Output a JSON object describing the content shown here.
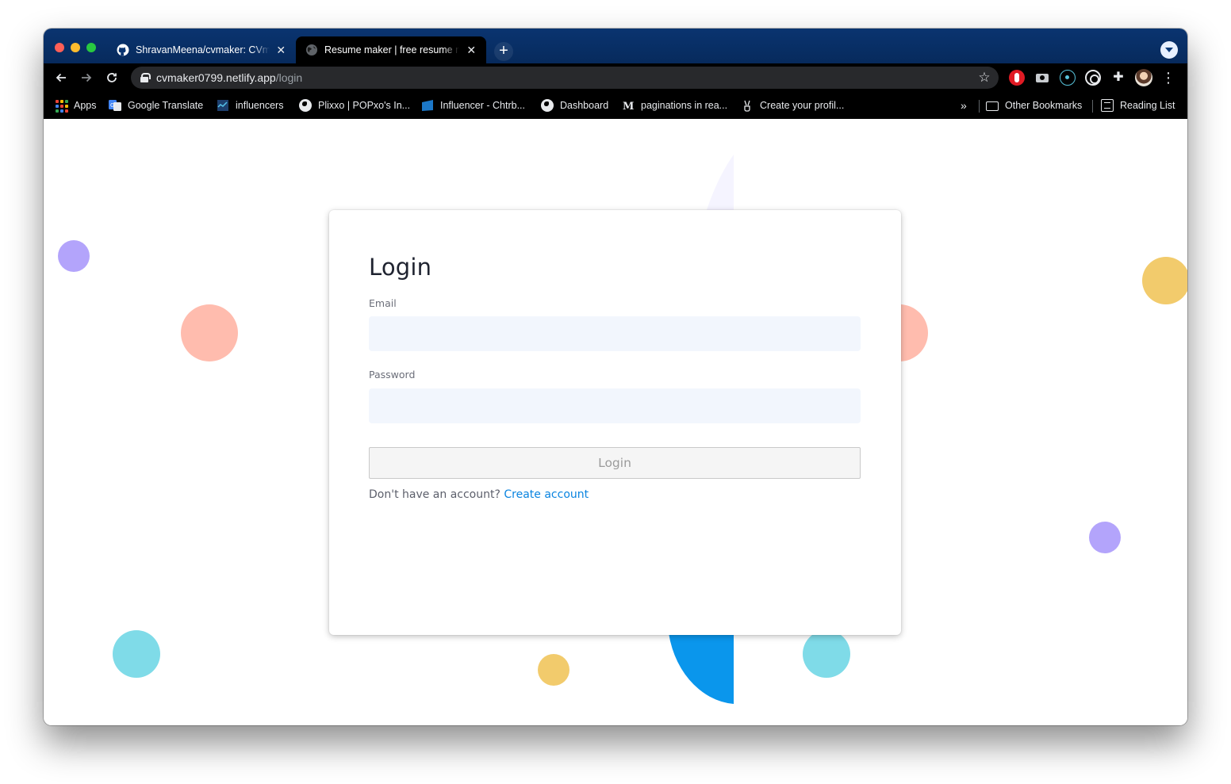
{
  "browser": {
    "tabs": [
      {
        "title": "ShravanMeena/cvmaker: CVmaker",
        "favicon": "github-icon"
      },
      {
        "title": "Resume maker | free resume maker",
        "favicon": "globe-icon",
        "active": true
      }
    ],
    "close_glyph": "✕",
    "new_tab_glyph": "+",
    "url": {
      "host": "cvmaker0799.netlify.app",
      "path": "/login"
    },
    "bookmarks": [
      {
        "label": "Apps"
      },
      {
        "label": "Google Translate"
      },
      {
        "label": "influencers"
      },
      {
        "label": "Plixxo | POPxo's In..."
      },
      {
        "label": "Influencer - Chtrb..."
      },
      {
        "label": "Dashboard"
      },
      {
        "label": "paginations in rea..."
      },
      {
        "label": "Create your profil..."
      }
    ],
    "bookmarks_overflow": "»",
    "other_bookmarks": "Other Bookmarks",
    "reading_list": "Reading List"
  },
  "login": {
    "title": "Login",
    "email_label": "Email",
    "email_value": "",
    "password_label": "Password",
    "password_value": "",
    "submit_label": "Login",
    "signup_prompt": "Don't have an account?",
    "signup_link": "Create account"
  },
  "colors": {
    "accent_blue": "#0a96ec",
    "link": "#0a84e0",
    "purple_dot": "#b3a4fb",
    "salmon_dot": "#ffbcae",
    "yellow_dot": "#f2cb6c",
    "cyan_dot": "#7fdbe8",
    "input_bg": "#f2f6fd"
  }
}
